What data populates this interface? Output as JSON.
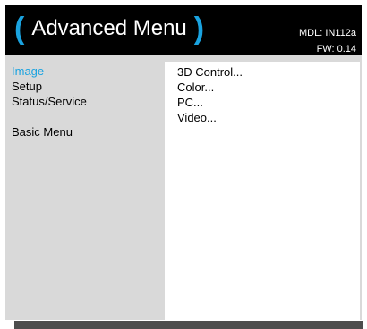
{
  "header": {
    "title": "Advanced Menu",
    "paren_left": "(",
    "paren_right": ")",
    "model": "MDL: IN112a",
    "firmware": "FW: 0.14"
  },
  "sidebar": {
    "items": [
      {
        "label": "Image",
        "selected": true
      },
      {
        "label": "Setup",
        "selected": false
      },
      {
        "label": "Status/Service",
        "selected": false
      }
    ],
    "basic_menu": "Basic Menu"
  },
  "submenu": {
    "items": [
      {
        "label": "3D Control..."
      },
      {
        "label": "Color..."
      },
      {
        "label": "PC..."
      },
      {
        "label": "Video..."
      }
    ]
  },
  "colors": {
    "accent": "#1aa3e0",
    "header_bg": "#000000",
    "body_bg": "#d9d9d9",
    "panel_bg": "#ffffff"
  }
}
